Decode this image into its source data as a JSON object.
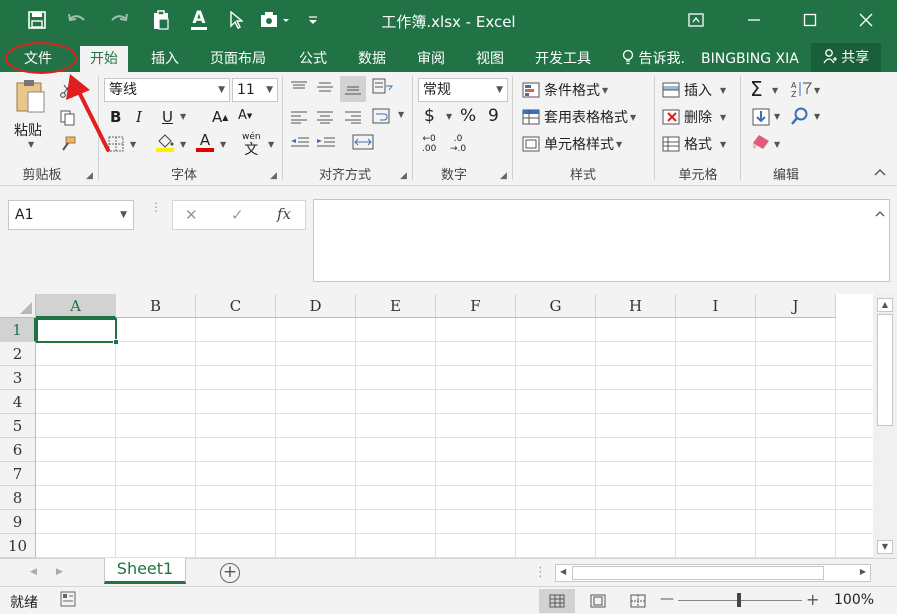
{
  "window": {
    "title": "工作簿.xlsx - Excel",
    "minimize": "—",
    "maximize": "☐",
    "close": "✕",
    "ribbon_display": "⊡"
  },
  "quick_access": {
    "save": "💾",
    "undo": "↶",
    "redo": "↷",
    "paste": "📋",
    "font_color": "A",
    "select": "↖",
    "customize": "⊻"
  },
  "tabs": [
    {
      "label": "文件",
      "active": false
    },
    {
      "label": "开始",
      "active": true
    },
    {
      "label": "插入",
      "active": false
    },
    {
      "label": "页面布局",
      "active": false
    },
    {
      "label": "公式",
      "active": false
    },
    {
      "label": "数据",
      "active": false
    },
    {
      "label": "审阅",
      "active": false
    },
    {
      "label": "视图",
      "active": false
    },
    {
      "label": "开发工具",
      "active": false
    }
  ],
  "tell_me": "告诉我.",
  "user": "BINGBING XIA",
  "share": "共享",
  "ribbon": {
    "clipboard": {
      "paste": "粘贴",
      "label": "剪贴板"
    },
    "font": {
      "name": "等线",
      "size": "11",
      "bold": "B",
      "italic": "I",
      "underline": "U",
      "grow": "A",
      "shrink": "A",
      "label": "字体",
      "phonetic": "wén\n文"
    },
    "alignment": {
      "label": "对齐方式"
    },
    "number": {
      "format": "常规",
      "currency": "$",
      "percent": "%",
      "comma": "9",
      "inc_decimal": ".00",
      "dec_decimal": ".0",
      "label": "数字"
    },
    "styles": {
      "conditional": "条件格式",
      "table": "套用表格格式",
      "cell": "单元格样式",
      "label": "样式"
    },
    "cells": {
      "insert": "插入",
      "delete": "删除",
      "format": "格式",
      "label": "单元格"
    },
    "editing": {
      "sum": "Σ",
      "sort": "A Z",
      "find": "⌕",
      "fill": "↓",
      "clear": "◆",
      "label": "编辑"
    }
  },
  "formula_bar": {
    "name_box": "A1",
    "cancel": "✕",
    "enter": "✓",
    "fx": "fx",
    "value": ""
  },
  "grid": {
    "columns": [
      "A",
      "B",
      "C",
      "D",
      "E",
      "F",
      "G",
      "H",
      "I",
      "J"
    ],
    "rows": [
      "1",
      "2",
      "3",
      "4",
      "5",
      "6",
      "7",
      "8",
      "9",
      "10"
    ],
    "active_cell": "A1"
  },
  "sheets": [
    {
      "name": "Sheet1",
      "active": true
    }
  ],
  "add_sheet": "+",
  "status": {
    "ready": "就绪",
    "zoom": "100%",
    "zoom_out": "—",
    "zoom_in": "+"
  },
  "colors": {
    "accent": "#217346",
    "annotation": "#e02020"
  }
}
